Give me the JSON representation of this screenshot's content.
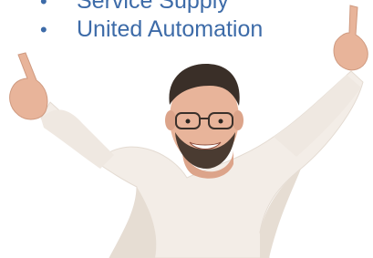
{
  "bullets": {
    "items": [
      {
        "label": "Service Supply"
      },
      {
        "label": "United Automation"
      }
    ],
    "marker": "•"
  },
  "photo": {
    "subject": "man-cheering-icon",
    "colors": {
      "text": "#3d6ba8",
      "skin": "#e8b49a",
      "shirt": "#f3ede7",
      "hair": "#3a2f28"
    }
  }
}
